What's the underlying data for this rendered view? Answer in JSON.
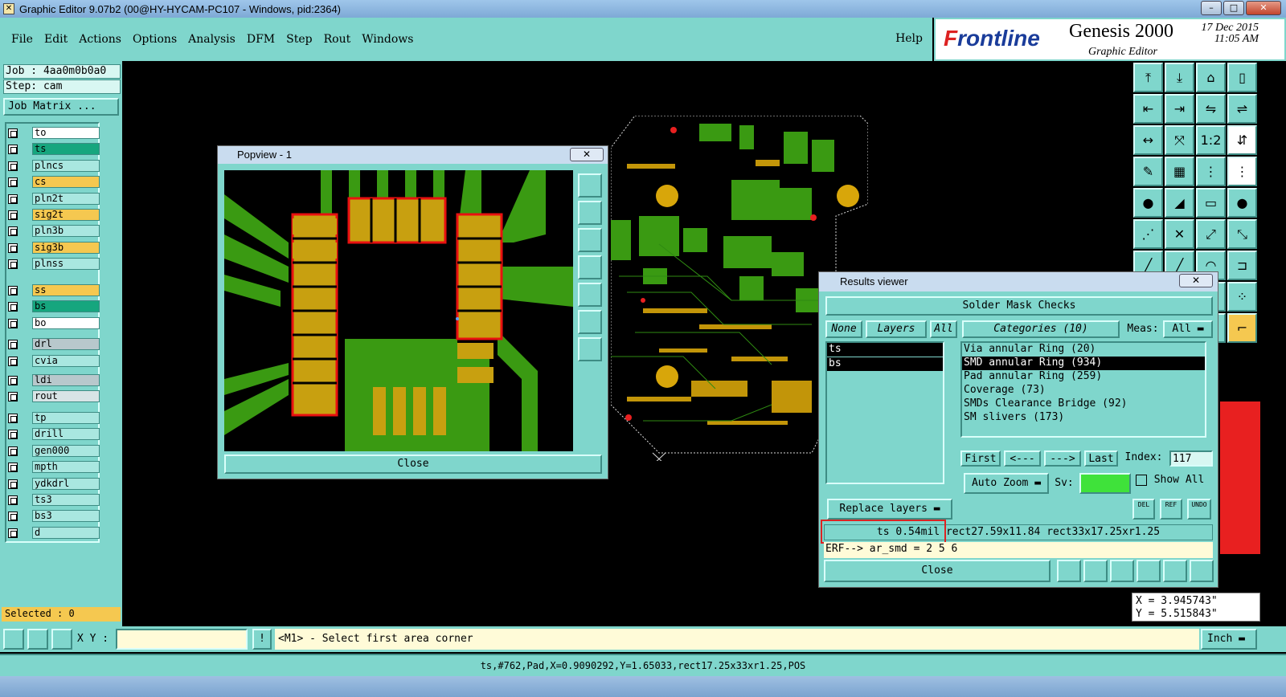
{
  "window": {
    "title": "Graphic Editor 9.07b2 (00@HY-HYCAM-PC107 - Windows, pid:2364)",
    "minimize": "–",
    "maximize": "□",
    "close": "✕"
  },
  "menu": {
    "items": [
      "File",
      "Edit",
      "Actions",
      "Options",
      "Analysis",
      "DFM",
      "Step",
      "Rout",
      "Windows"
    ],
    "help": "Help"
  },
  "brand": {
    "company_pre": "F",
    "company_rest": "rontline",
    "product": "Genesis 2000",
    "subtitle": "Graphic Editor",
    "date": "17 Dec 2015",
    "time": "11:05 AM"
  },
  "job": {
    "job_line": "Job : 4aa0m0b0a0",
    "step_line": "Step: cam",
    "matrix_button": "Job Matrix ...",
    "selected": "Selected : 0"
  },
  "layers": [
    {
      "name": "to",
      "color": "#ffffff"
    },
    {
      "name": "ts",
      "color": "#16a67e"
    },
    {
      "name": "plncs",
      "color": "#a9e7e0"
    },
    {
      "name": "cs",
      "color": "#f5c850"
    },
    {
      "name": "pln2t",
      "color": "#a9e7e0"
    },
    {
      "name": "sig2t",
      "color": "#f5c850"
    },
    {
      "name": "pln3b",
      "color": "#a9e7e0"
    },
    {
      "name": "sig3b",
      "color": "#f5c850"
    },
    {
      "name": "plnss",
      "color": "#a9e7e0"
    },
    {
      "name": "ss",
      "color": "#f5c850"
    },
    {
      "name": "bs",
      "color": "#16a67e"
    },
    {
      "name": "bo",
      "color": "#ffffff"
    },
    {
      "name": "drl",
      "color": "#b8c8cc"
    },
    {
      "name": "cvia",
      "color": "#a9e7e0"
    },
    {
      "name": "ldi",
      "color": "#b8c8cc"
    },
    {
      "name": "rout",
      "color": "#d8e4e6"
    },
    {
      "name": "tp",
      "color": "#a9e7e0"
    },
    {
      "name": "drill",
      "color": "#a9e7e0"
    },
    {
      "name": "gen000",
      "color": "#a9e7e0"
    },
    {
      "name": "mpth",
      "color": "#a9e7e0"
    },
    {
      "name": "ydkdrl",
      "color": "#a9e7e0"
    },
    {
      "name": "ts3",
      "color": "#a9e7e0"
    },
    {
      "name": "bs3",
      "color": "#a9e7e0"
    },
    {
      "name": "d",
      "color": "#a9e7e0"
    }
  ],
  "popview": {
    "title": "Popview - 1",
    "close": "Close"
  },
  "results": {
    "title": "Results viewer",
    "header": "Solder Mask Checks",
    "none": "None",
    "layers": "Layers",
    "all": "All",
    "categories": "Categories (10)",
    "meas_label": "Meas:",
    "meas_value": "All",
    "layer_items": [
      "ts",
      "bs"
    ],
    "category_items": [
      "Via annular Ring (20)",
      "SMD annular Ring (934)",
      "Pad annular Ring (259)",
      "Coverage (73)",
      "SMDs Clearance Bridge (92)",
      "SM slivers (173)"
    ],
    "nav": {
      "first": "First",
      "prev": "<---",
      "next": "--->",
      "last": "Last",
      "index_label": "Index:",
      "index_value": "117"
    },
    "auto_zoom": "Auto Zoom",
    "sv": "Sv:",
    "show_all": "Show All",
    "replace_layers": "Replace layers",
    "small_buttons": [
      "DEL",
      "REF",
      "UNDO"
    ],
    "measurement": "ts 0.54mil  rect27.59x11.84  rect33x17.25xr1.25",
    "erf": "ERF--> ar_smd = 2 5 6",
    "close": "Close"
  },
  "coords": {
    "x": "X = 3.945743\"",
    "y": "Y = 5.515843\""
  },
  "command": {
    "xy_label": "X Y :",
    "xy_value": "",
    "prompt": "<M1> - Select first area corner",
    "units": "Inch"
  },
  "status": "ts,#762,Pad,X=0.9090292,Y=1.65033,rect17.25x33xr1.25,POS"
}
